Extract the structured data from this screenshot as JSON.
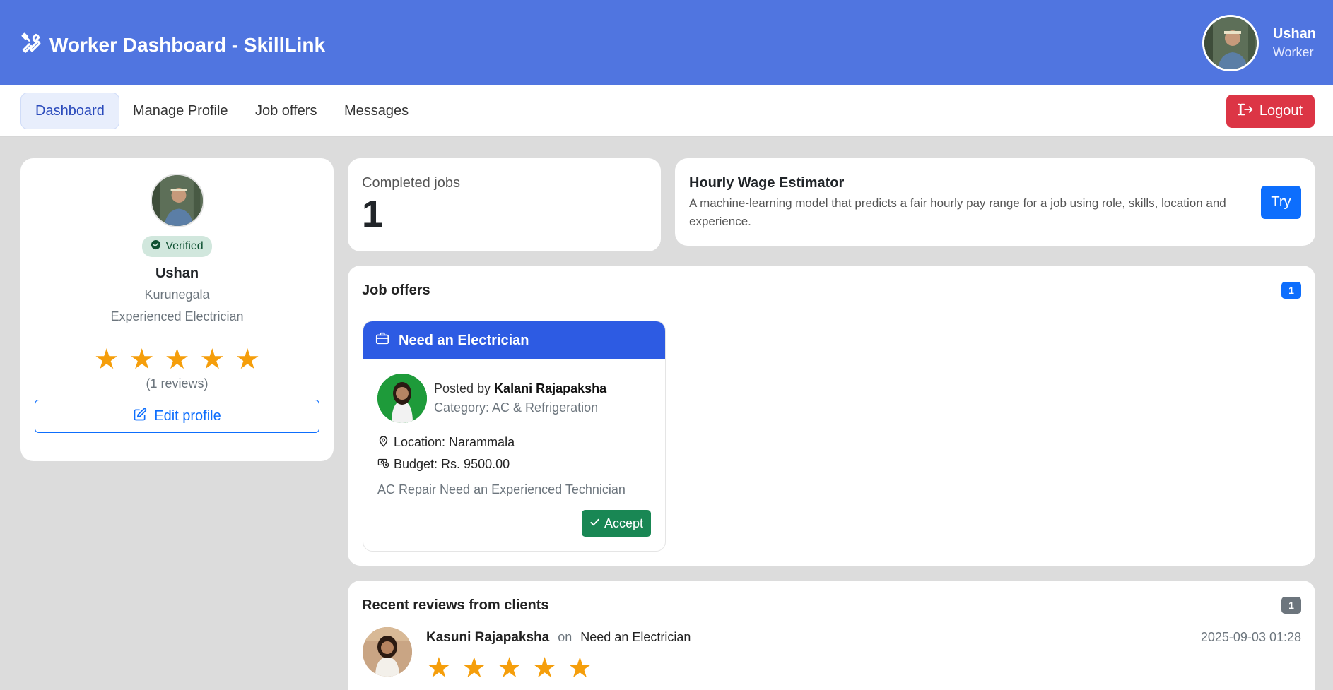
{
  "app": {
    "title": "Worker Dashboard - SkillLink",
    "icon": "tools-icon"
  },
  "user": {
    "name": "Ushan",
    "role": "Worker"
  },
  "nav": {
    "tabs": [
      {
        "label": "Dashboard",
        "active": true
      },
      {
        "label": "Manage Profile",
        "active": false
      },
      {
        "label": "Job offers",
        "active": false
      },
      {
        "label": "Messages",
        "active": false
      }
    ],
    "logout_label": "Logout"
  },
  "profile": {
    "verified_label": "Verified",
    "name": "Ushan",
    "city": "Kurunegala",
    "title": "Experienced Electrician",
    "stars": "★★★★★",
    "rating": 5,
    "reviews_text": "(1 reviews)",
    "edit_label": "Edit profile"
  },
  "stats": {
    "completed_label": "Completed jobs",
    "completed_value": "1"
  },
  "estimator": {
    "title": "Hourly Wage Estimator",
    "description": "A machine-learning model that predicts a fair hourly pay range for a job using role, skills, location and experience.",
    "button_label": "Try"
  },
  "job_offers": {
    "title": "Job offers",
    "count": "1",
    "items": [
      {
        "title": "Need an Electrician",
        "posted_by_prefix": "Posted by ",
        "poster": "Kalani Rajapaksha",
        "category": "Category: AC & Refrigeration",
        "location": "Location: Narammala",
        "budget": "Budget: Rs. 9500.00",
        "description": "AC Repair Need an Experienced Technician",
        "accept_label": "Accept"
      }
    ]
  },
  "reviews": {
    "title": "Recent reviews from clients",
    "count": "1",
    "items": [
      {
        "client": "Kasuni Rajapaksha",
        "on": "on",
        "job": "Need an Electrician",
        "date": "2025-09-03 01:28",
        "stars": "★★★★★",
        "rating": 5
      }
    ]
  },
  "colors": {
    "header": "#5075e0",
    "primary": "#0d6efd",
    "danger": "#dc3545",
    "success": "#198754",
    "star": "#f59e0b",
    "job_header": "#2d5be3"
  }
}
